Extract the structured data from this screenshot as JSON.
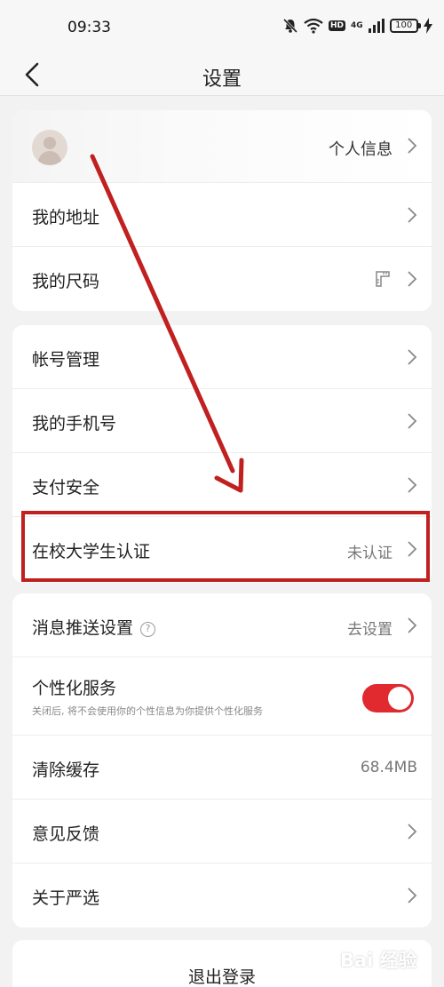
{
  "status_bar": {
    "time": "09:33",
    "hd": "HD",
    "signal": "4G",
    "battery": "100",
    "icons": [
      "mute-bell-icon",
      "wifi-icon",
      "hd-icon",
      "signal-icon",
      "battery-icon",
      "charging-icon"
    ]
  },
  "nav": {
    "title": "设置",
    "back_icon": "chevron-left-icon"
  },
  "profile": {
    "label": "个人信息"
  },
  "group1": {
    "items": [
      {
        "label": "我的地址"
      },
      {
        "label": "我的尺码",
        "icon": "ruler-icon"
      }
    ]
  },
  "group2": {
    "items": [
      {
        "label": "帐号管理"
      },
      {
        "label": "我的手机号"
      },
      {
        "label": "支付安全"
      },
      {
        "label": "在校大学生认证",
        "value": "未认证"
      }
    ]
  },
  "group3": {
    "push": {
      "label": "消息推送设置",
      "value": "去设置"
    },
    "personal": {
      "label": "个性化服务",
      "desc": "关闭后, 将不会使用你的个性信息为你提供个性化服务",
      "enabled": true
    },
    "cache": {
      "label": "清除缓存",
      "value": "68.4MB"
    },
    "feedback": {
      "label": "意见反馈"
    },
    "about": {
      "label": "关于严选"
    }
  },
  "logout": {
    "label": "退出登录"
  },
  "watermark": {
    "text": "Bai 经验"
  },
  "colors": {
    "accent": "#e02a2f",
    "annotation": "#c0201f",
    "background": "#f2f2f2"
  }
}
